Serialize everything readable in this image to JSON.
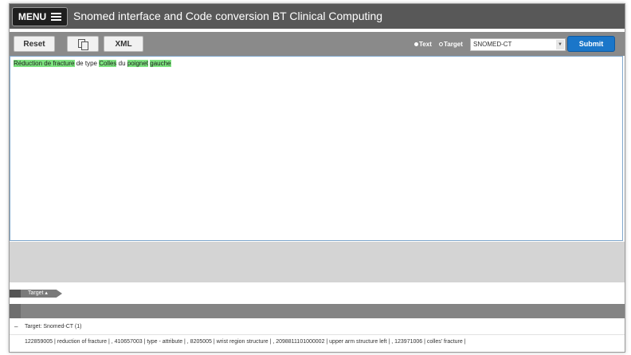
{
  "header": {
    "menu_label": "MENU",
    "title": "Snomed interface and Code conversion BT Clinical Computing"
  },
  "toolbar": {
    "reset_label": "Reset",
    "copy_icon": "copy-icon",
    "xml_label": "XML",
    "radio_text_label": "Text",
    "radio_target_label": "Target",
    "selected_radio": "Text",
    "target_select_value": "SNOMED-CT",
    "submit_label": "Submit",
    "submit_color": "#1a76c9"
  },
  "editor": {
    "segments": [
      {
        "text": "Réduction de fracture",
        "highlight": true
      },
      {
        "text": " de type ",
        "highlight": false
      },
      {
        "text": "Colles",
        "highlight": true
      },
      {
        "text": " du ",
        "highlight": false
      },
      {
        "text": "poignet",
        "highlight": true
      },
      {
        "text": " ",
        "highlight": false
      },
      {
        "text": "gauche",
        "highlight": true
      }
    ],
    "highlight_color": "#7de37f"
  },
  "target_tab": {
    "label": "Target ▴"
  },
  "results": {
    "collapse_symbol": "–",
    "group_label": "Target: Snomed-CT (1)",
    "codes_line": "122859005 | reduction of fracture | , 410657003 | type - attribute | , 8205005 | wrist region structure | , 2098811101000002 | upper arm structure left | , 123971006 | colles' fracture |"
  }
}
